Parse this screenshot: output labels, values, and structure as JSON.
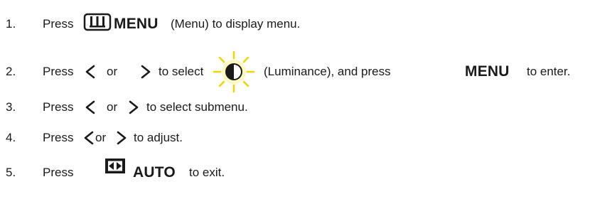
{
  "steps": [
    {
      "number": "1.",
      "press": "Press",
      "icon": "menu-button-icon",
      "key": "MENU",
      "rest": "(Menu) to display menu."
    },
    {
      "number": "2.",
      "press": "Press",
      "left_icon": "chevron-left-icon",
      "or": "or",
      "right_icon": "chevron-right-icon",
      "to_select": "to select",
      "menu_icon": "luminance-icon",
      "paren": "(Luminance), and press",
      "key": "MENU",
      "rest": "to enter."
    },
    {
      "number": "3.",
      "press": "Press",
      "left_icon": "chevron-left-icon",
      "or": "or",
      "right_icon": "chevron-right-icon",
      "rest": "to select submenu."
    },
    {
      "number": "4.",
      "press": "Press",
      "left_icon": "chevron-left-icon",
      "or": "or",
      "right_icon": "chevron-right-icon",
      "rest": "to adjust."
    },
    {
      "number": "5.",
      "press": "Press",
      "icon": "auto-button-icon",
      "key": "AUTO",
      "rest": "to exit."
    }
  ],
  "colors": {
    "text": "#1a1a1a",
    "sun_yellow": "#f2d500",
    "sun_halo": "#fff7a0"
  }
}
